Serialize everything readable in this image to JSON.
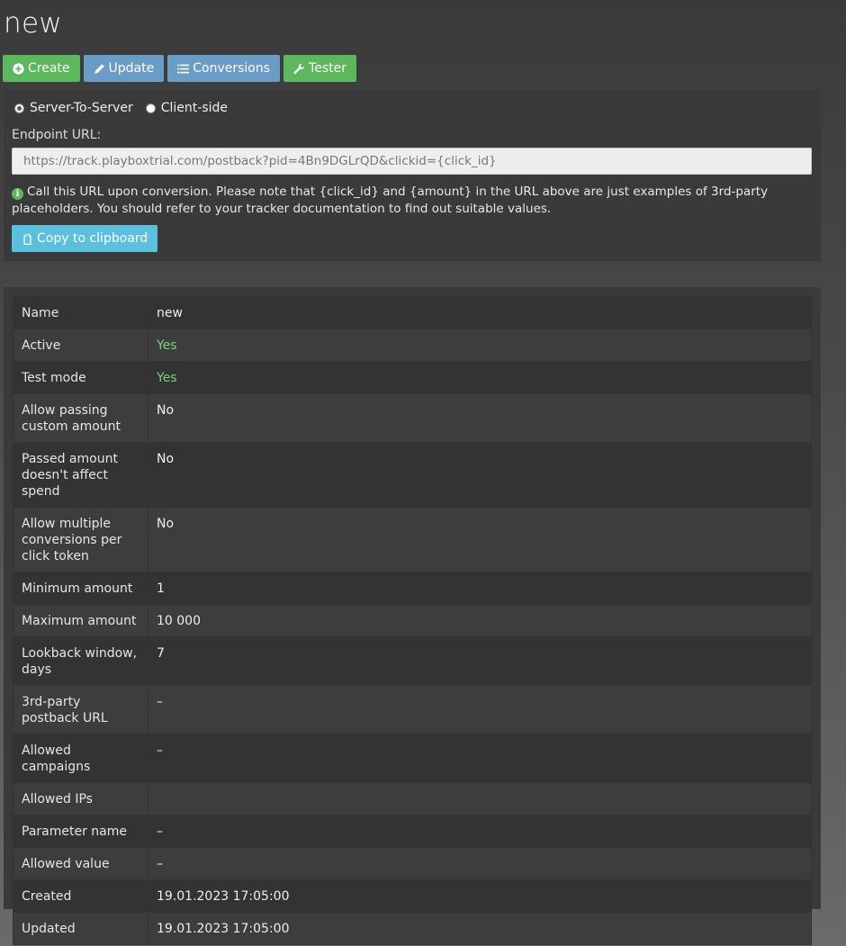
{
  "page": {
    "title": "new"
  },
  "toolbar": {
    "create_label": "Create",
    "update_label": "Update",
    "conversions_label": "Conversions",
    "tester_label": "Tester"
  },
  "postback": {
    "radio_options": [
      {
        "label": "Server-To-Server",
        "selected": true
      },
      {
        "label": "Client-side",
        "selected": false
      }
    ],
    "endpoint_label": "Endpoint URL:",
    "endpoint_url": "https://track.playboxtrial.com/postback?pid=4Bn9DGLrQD&clickid={click_id}",
    "note": "Call this URL upon conversion. Please note that {click_id} and {amount} in the URL above are just examples of 3rd-party placeholders. You should refer to your tracker documentation to find out suitable values.",
    "copy_label": "Copy to clipboard"
  },
  "details": [
    {
      "key": "Name",
      "value": "new"
    },
    {
      "key": "Active",
      "value": "Yes"
    },
    {
      "key": "Test mode",
      "value": "Yes"
    },
    {
      "key": "Allow passing custom amount",
      "value": "No"
    },
    {
      "key": "Passed amount doesn't affect spend",
      "value": "No"
    },
    {
      "key": "Allow multiple conversions per click token",
      "value": "No"
    },
    {
      "key": "Minimum amount",
      "value": "1"
    },
    {
      "key": "Maximum amount",
      "value": "10 000"
    },
    {
      "key": "Lookback window, days",
      "value": "7"
    },
    {
      "key": "3rd-party postback URL",
      "value": "–"
    },
    {
      "key": "Allowed campaigns",
      "value": "–"
    },
    {
      "key": "Allowed IPs",
      "value": ""
    },
    {
      "key": "Parameter name",
      "value": "–"
    },
    {
      "key": "Allowed value",
      "value": "–"
    },
    {
      "key": "Created",
      "value": "19.01.2023 17:05:00"
    },
    {
      "key": "Updated",
      "value": "19.01.2023 17:05:00"
    }
  ],
  "colors": {
    "green_button": "#5cb85c",
    "blue_button": "#6a9cc8",
    "cyan_button": "#5bc0de",
    "yes_text": "#7ed07e"
  }
}
